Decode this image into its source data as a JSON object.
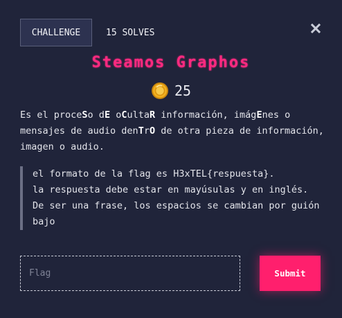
{
  "tabs": {
    "challenge_label": "CHALLENGE",
    "solves_label": "15 SOLVES"
  },
  "close_icon": "close-icon",
  "challenge": {
    "title": "Steamos Graphos",
    "points": "25",
    "coin_icon": "coin-icon",
    "description_segments": [
      {
        "text": "Es el proce",
        "bold": false
      },
      {
        "text": "S",
        "bold": true
      },
      {
        "text": "o d",
        "bold": false
      },
      {
        "text": "E",
        "bold": true
      },
      {
        "text": " o",
        "bold": false
      },
      {
        "text": "C",
        "bold": true
      },
      {
        "text": "ulta",
        "bold": false
      },
      {
        "text": "R",
        "bold": true
      },
      {
        "text": " información, imág",
        "bold": false
      },
      {
        "text": "E",
        "bold": true
      },
      {
        "text": "nes o mensajes de audio den",
        "bold": false
      },
      {
        "text": "T",
        "bold": true
      },
      {
        "text": "r",
        "bold": false
      },
      {
        "text": "O",
        "bold": true
      },
      {
        "text": " de otra pieza de información, imagen o audio.",
        "bold": false
      }
    ],
    "quote_lines": [
      "el formato de la flag es H3xTEL{respuesta}.",
      "la respuesta debe estar en mayúsulas y en inglés.",
      "De ser una frase, los espacios se cambian por guión bajo"
    ]
  },
  "form": {
    "flag_placeholder": "Flag",
    "flag_value": "",
    "submit_label": "Submit"
  },
  "colors": {
    "background": "#20243a",
    "accent": "#ff1f6d",
    "title": "#ff2a80",
    "coin": "#f2b01e"
  }
}
